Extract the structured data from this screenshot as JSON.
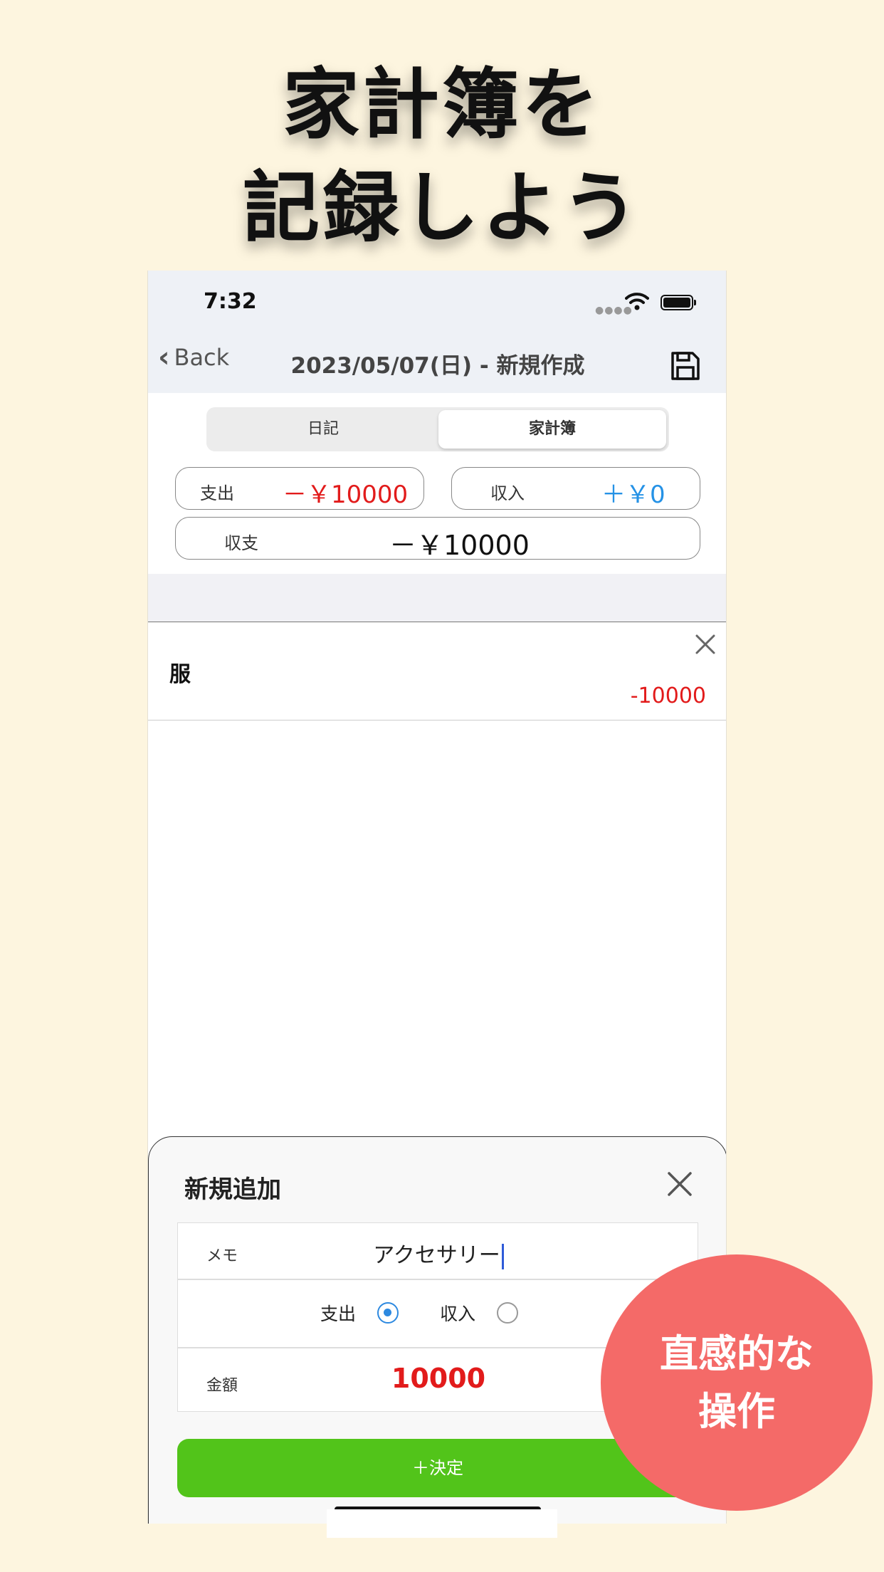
{
  "headline": {
    "line1": "家計簿を",
    "line2": "記録しよう"
  },
  "status_bar": {
    "time": "7:32"
  },
  "nav": {
    "back_label": "Back",
    "title": "2023/05/07(日) - 新規作成"
  },
  "segment": {
    "items": [
      "日記",
      "家計簿"
    ],
    "selected": "家計簿"
  },
  "summary": {
    "expense_label": "支出",
    "expense_value": "－￥10000",
    "income_label": "収入",
    "income_value": "＋￥0",
    "balance_label": "収支",
    "balance_value": "－￥10000"
  },
  "entries": [
    {
      "name": "服",
      "amount": "-10000"
    }
  ],
  "sheet": {
    "title": "新規追加",
    "memo_label": "メモ",
    "memo_value": "アクセサリー",
    "type_expense": "支出",
    "type_income": "収入",
    "selected_type": "支出",
    "amount_label": "金額",
    "amount_value": "10000",
    "confirm_label": "＋決定"
  },
  "badge": {
    "line1": "直感的な",
    "line2": "操作"
  },
  "colors": {
    "background": "#fdf5df",
    "expense": "#e21b1b",
    "income": "#2592e6",
    "confirm": "#52c41a",
    "badge": "#f46a68",
    "radio": "#2d89e0"
  }
}
